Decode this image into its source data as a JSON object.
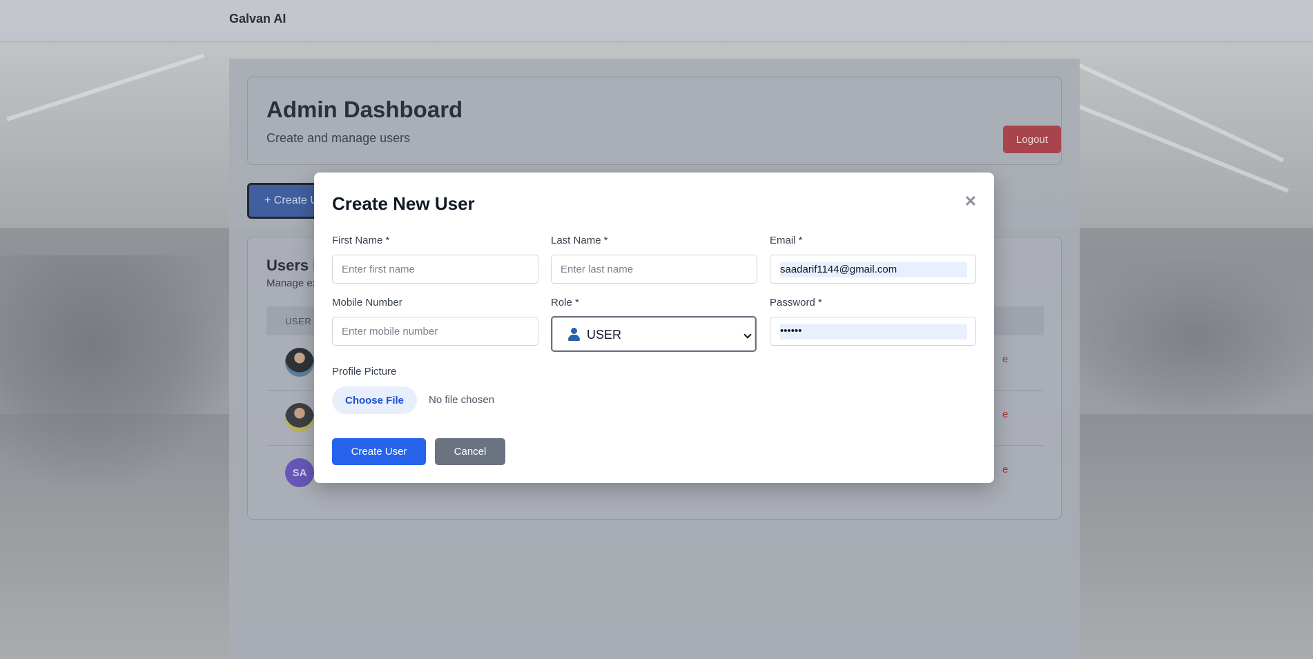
{
  "app": {
    "brand": "Galvan AI"
  },
  "dashboard": {
    "title": "Admin Dashboard",
    "subtitle": "Create and manage users",
    "logout_label": "Logout",
    "create_user_button_label": "+ Create User"
  },
  "users_section": {
    "title": "Users List",
    "subtitle": "Manage existing users",
    "column_user": "USER",
    "rows": [
      {
        "avatar": "photo"
      },
      {
        "avatar": "photo"
      },
      {
        "avatar": "initials",
        "initials": "SA"
      }
    ]
  },
  "modal": {
    "title": "Create New User",
    "close_icon": "close-icon",
    "fields": {
      "first_name": {
        "label": "First Name *",
        "placeholder": "Enter first name",
        "value": ""
      },
      "last_name": {
        "label": "Last Name *",
        "placeholder": "Enter last name",
        "value": ""
      },
      "email": {
        "label": "Email *",
        "value": "saadarif1144@gmail.com"
      },
      "mobile": {
        "label": "Mobile Number",
        "placeholder": "Enter mobile number",
        "value": ""
      },
      "role": {
        "label": "Role *",
        "value": "USER",
        "icon": "person-icon"
      },
      "password": {
        "label": "Password *",
        "value": "••••••"
      },
      "profile_picture": {
        "label": "Profile Picture",
        "choose_label": "Choose File",
        "status": "No file chosen"
      }
    },
    "submit_label": "Create User",
    "cancel_label": "Cancel"
  },
  "colors": {
    "primary": "#2563eb",
    "secondary": "#6b7280",
    "danger": "#a8444c",
    "overlay": "#9da1a8"
  }
}
